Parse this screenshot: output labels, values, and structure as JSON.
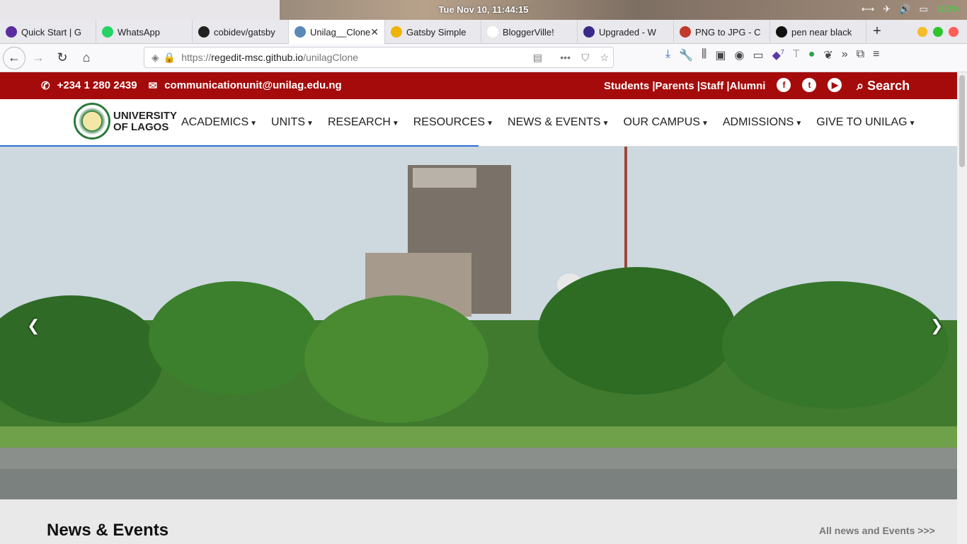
{
  "os": {
    "clock": "Tue Nov 10, 11:44:15",
    "battery": "100%"
  },
  "tabs": [
    {
      "label": "Quick Start | G",
      "color": "#5b2ca0",
      "icon": "gatsby-icon"
    },
    {
      "label": "WhatsApp",
      "color": "#25d366",
      "icon": "whatsapp-icon"
    },
    {
      "label": "cobidev/gatsby",
      "color": "#222222",
      "icon": "github-icon"
    },
    {
      "label": "Unilag__Clone",
      "color": "#5a88b7",
      "icon": "globe-icon",
      "active": true
    },
    {
      "label": "Gatsby Simple",
      "color": "#f0b400",
      "icon": "bolt-icon"
    },
    {
      "label": "BloggerVille!",
      "color": "#ffffff",
      "icon": "none"
    },
    {
      "label": "Upgraded - W",
      "color": "#3b2a8a",
      "icon": "cube-icon"
    },
    {
      "label": "PNG to JPG - C",
      "color": "#c0392b",
      "icon": "png-icon"
    },
    {
      "label": "pen near black",
      "color": "#111111",
      "icon": "unsplash-icon"
    }
  ],
  "toolbar": {
    "url_prefix": "https://",
    "url_host": "regedit-msc.github.io",
    "url_path": "/unilagClone",
    "extension_badge": "7"
  },
  "site": {
    "phone": "+234 1 280 2439",
    "email": "communicationunit@unilag.edu.ng",
    "audience_links": "Students |Parents |Staff |Alumni",
    "search_label": "Search",
    "logo_text_line1": "UNIVERSITY",
    "logo_text_line2": "OF LAGOS",
    "menu": [
      "ACADEMICS",
      "UNITS",
      "RESEARCH",
      "RESOURCES",
      "NEWS & EVENTS",
      "OUR CAMPUS",
      "ADMISSIONS",
      "GIVE TO UNILAG"
    ],
    "news_title": "News & Events",
    "news_link": "All news and Events >>>"
  },
  "colors": {
    "brand_red": "#a50b0b",
    "accent_blue": "#2e6fd1"
  }
}
